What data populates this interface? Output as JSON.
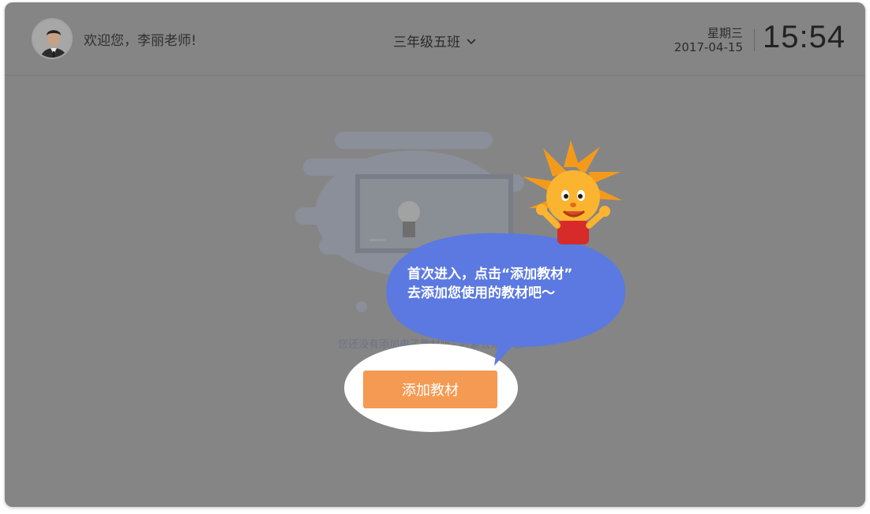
{
  "header": {
    "welcome": "欢迎您，李丽老师!",
    "class_name": "三年级五班",
    "weekday": "星期三",
    "date": "2017-04-15",
    "time": "15:54"
  },
  "main": {
    "empty_message": "您还没有添加电子教材哦~ 赶紧去添加吧!",
    "add_button_label": "添加教材"
  },
  "guide": {
    "line1": "首次进入，点击“添加教材”",
    "line2": "去添加您使用的教材吧～"
  },
  "colors": {
    "overlay": "#858585",
    "button": "#f59a52",
    "bubble": "#5b79e0"
  }
}
